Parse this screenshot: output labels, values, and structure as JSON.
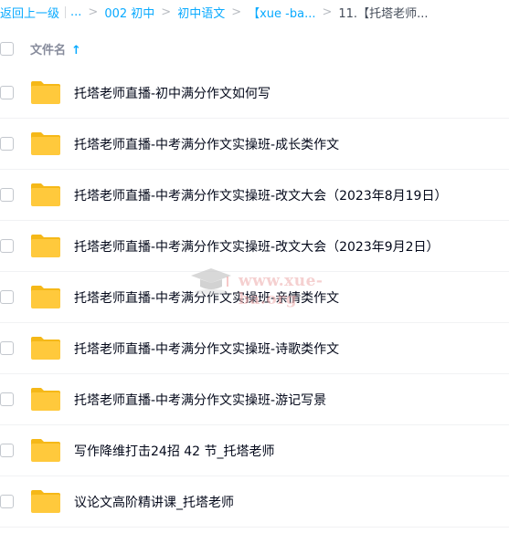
{
  "breadcrumb": {
    "back": "返回上一级",
    "ellipsis": "...",
    "items": [
      "002 初中",
      "初中语文",
      "【xue -ba...",
      "11.【托塔老师..."
    ],
    "separator": ">"
  },
  "header": {
    "column_name": "文件名",
    "sort_icon": "arrow-up-icon",
    "sort_glyph": "↑"
  },
  "files": [
    "托塔老师直播-初中满分作文如何写",
    "托塔老师直播-中考满分作文实操班-成长类作文",
    "托塔老师直播-中考满分作文实操班-改文大会（2023年8月19日）",
    "托塔老师直播-中考满分作文实操班-改文大会（2023年9月2日）",
    "托塔老师直播-中考满分作文实操班-亲情类作文",
    "托塔老师直播-中考满分作文实操班-诗歌类作文",
    "托塔老师直播-中考满分作文实操班-游记写景",
    "写作降维打击24招 42 节_托塔老师",
    "议论文高阶精讲课_托塔老师"
  ],
  "watermark": {
    "text": "www.xue-ba.org"
  },
  "colors": {
    "accent": "#09aaff",
    "folder": "#ffc93c",
    "folder_tab": "#f5b818"
  }
}
